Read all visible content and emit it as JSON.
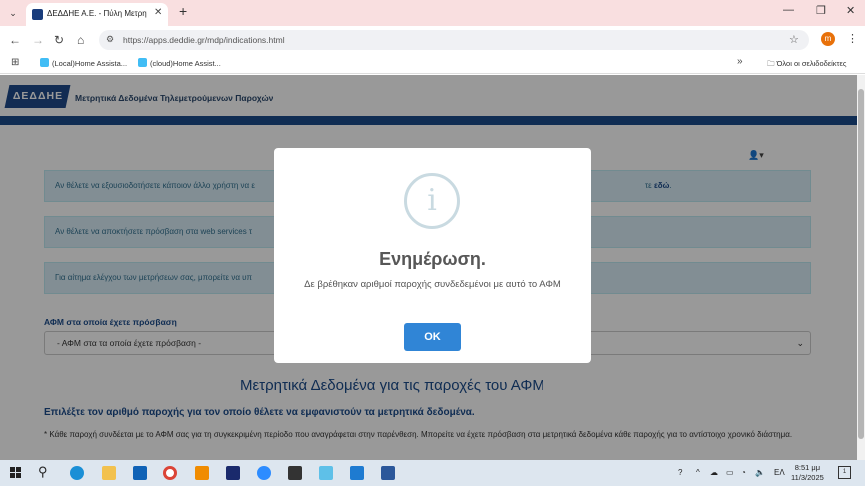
{
  "browser": {
    "tab_title": "ΔΕΔΔΗΕ Α.Ε. - Πύλη Μετρητικώ",
    "tab_close": "✕",
    "new_tab": "+",
    "url": "https://apps.deddie.gr/mdp/indications.html",
    "profile_initial": "m",
    "bookmarks": [
      "(Local)Home Assista...",
      "(cloud)Home Assist..."
    ],
    "all_bookmarks": "Όλοι οι σελιδοδείκτες"
  },
  "site": {
    "logo_text": "ΔΕΔΔΗΕ",
    "title": "Μετρητικά Δεδομένα Τηλεμετρούμενων Παροχών"
  },
  "alerts": [
    {
      "text": "Αν θέλετε να εξουσιοδοτήσετε κάποιον άλλο χρήστη να ε",
      "link_tail": "τε",
      "link": "εδώ"
    },
    {
      "text": "Αν θέλετε να αποκτήσετε πρόσβαση στα web services τ"
    },
    {
      "text": "Για αίτημα ελέγχου των μετρήσεων σας, μπορείτε να υπ"
    }
  ],
  "afm": {
    "label": "ΑΦΜ στα οποία έχετε πρόσβαση",
    "selected": "- ΑΦΜ στα τα οποία έχετε πρόσβαση -"
  },
  "data_section": {
    "title": "Μετρητικά Δεδομένα για τις παροχές του ΑΦΜ :",
    "choose": "Επιλέξτε τον αριθμό παροχής για τον οποίο θέλετε να εμφανιστούν τα μετρητικά δεδομένα.",
    "note": "* Κάθε παροχή συνδέεται με το ΑΦΜ σας για τη συγκεκριμένη περίοδο που αναγράφεται στην παρένθεση. Μπορείτε να έχετε πρόσβαση στα μετρητικά δεδομένα κάθε παροχής για το αντίστοιχο χρονικό διάστημα."
  },
  "modal": {
    "icon": "i",
    "title": "Ενημέρωση.",
    "text": "Δε βρέθηκαν αριθμοί παροχής συνδεδεμένοι με αυτό το ΑΦΜ",
    "ok": "OK"
  },
  "taskbar": {
    "lang": "ΕΛ",
    "time": "8:51 μμ",
    "date": "11/3/2025",
    "notifications": "1"
  }
}
